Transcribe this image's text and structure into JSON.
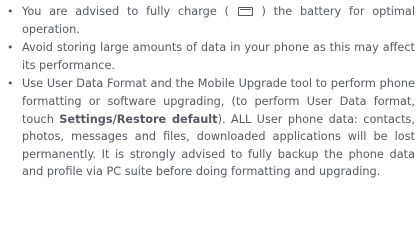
{
  "items": [
    {
      "bullet": "•",
      "before": "You are advised to fully charge (",
      "icon": "battery-icon",
      "after": ") the battery for optimal operation."
    },
    {
      "bullet": "•",
      "text": "Avoid storing large amounts of data in your phone as this may affect its performance."
    },
    {
      "bullet": "•",
      "before": "Use User Data Format and the Mobile Upgrade tool to perform phone formatting or software upgrading, (to perform User Data format, touch ",
      "bold": "Settings/Restore default",
      "after": "). ALL User phone data: contacts, photos, messages and files, downloaded applications will be lost permanently. It is strongly advised to fully backup the phone data and profile via PC suite before doing formatting and upgrading."
    }
  ]
}
